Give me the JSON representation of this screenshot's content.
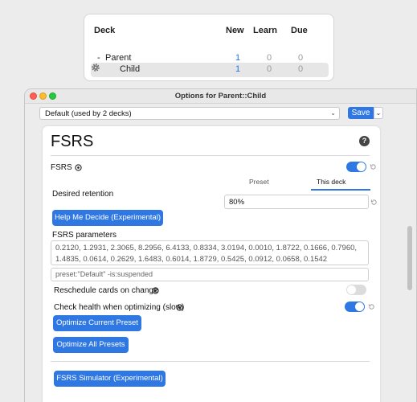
{
  "deck_browser": {
    "headers": {
      "deck": "Deck",
      "new": "New",
      "learn": "Learn",
      "due": "Due"
    },
    "rows": [
      {
        "collapse": "-",
        "name": "Parent",
        "new": "1",
        "learn": "0",
        "due": "0"
      },
      {
        "name": "Child",
        "new": "1",
        "learn": "0",
        "due": "0"
      }
    ]
  },
  "window": {
    "title": "Options for Parent::Child",
    "preset_selected": "Default (used by 2 decks)",
    "save_label": "Save"
  },
  "fsrs": {
    "section_title": "FSRS",
    "help_label": "?",
    "toggle_label": "FSRS",
    "fsrs_enabled": true,
    "retention_label": "Desired retention",
    "tabs": [
      "Preset",
      "This deck"
    ],
    "active_tab": "This deck",
    "retention_value": "80%",
    "help_me_decide": "Help Me Decide (Experimental)",
    "params_label": "FSRS parameters",
    "params_value": "0.2120, 1.2931, 2.3065, 8.2956, 6.4133, 0.8334, 3.0194, 0.0010, 1.8722, 0.1666, 0.7960, 1.4835, 0.0614, 0.2629, 1.6483, 0.6014, 1.8729, 0.5425, 0.0912, 0.0658, 0.1542",
    "search_value": "preset:\"Default\" -is:suspended",
    "reschedule_label": "Reschedule cards on change",
    "reschedule_enabled": false,
    "health_label": "Check health when optimizing (slow)",
    "health_enabled": true,
    "optimize_current": "Optimize Current Preset",
    "optimize_all": "Optimize All Presets",
    "simulator": "FSRS Simulator (Experimental)"
  },
  "colors": {
    "accent": "#2f78e4",
    "new_count": "#1a73e8"
  }
}
